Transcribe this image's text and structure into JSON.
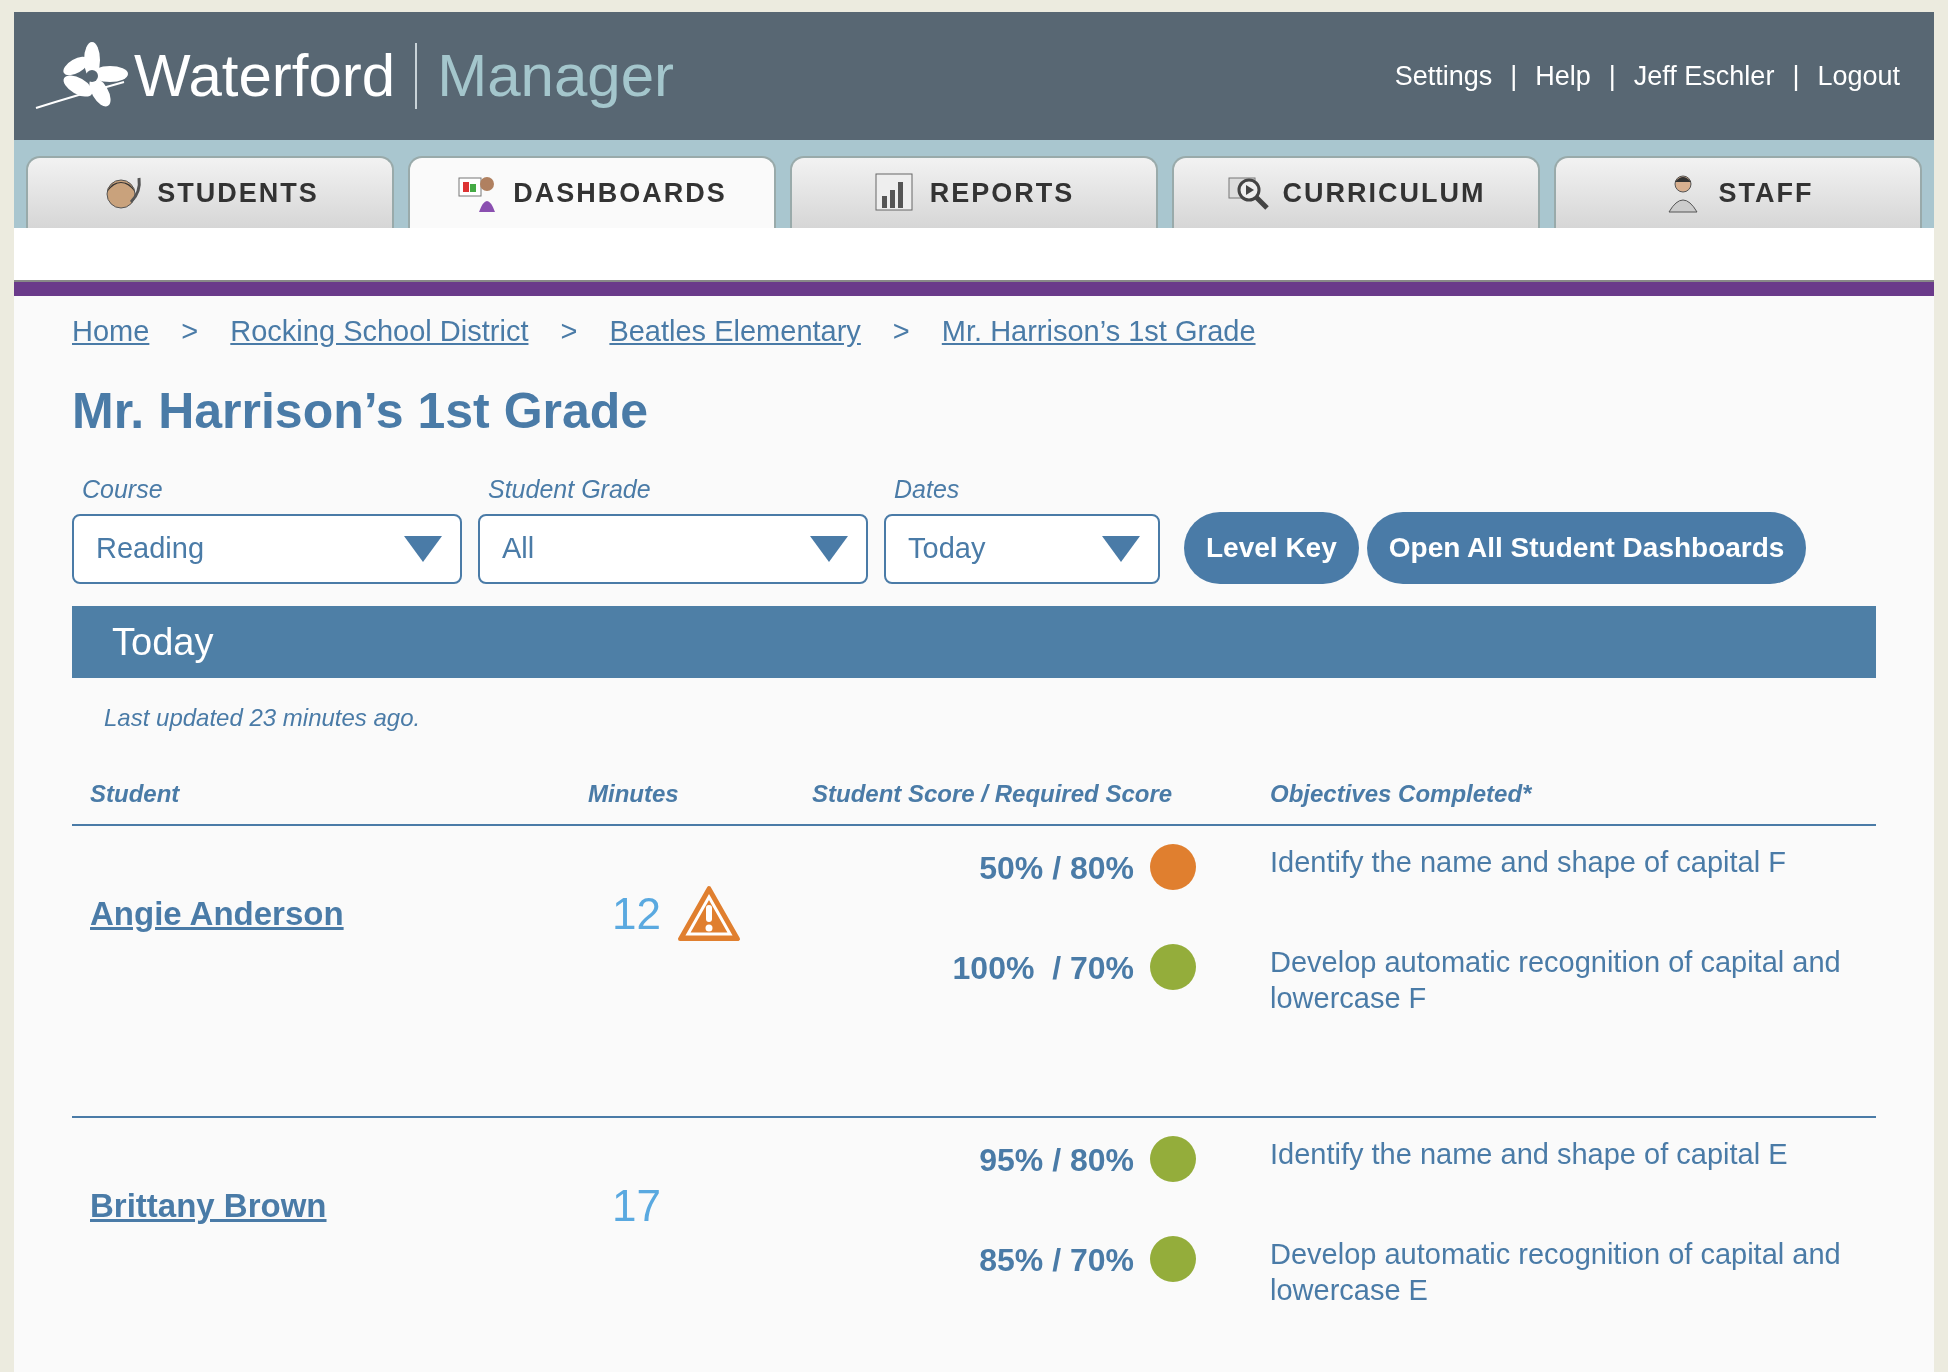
{
  "header": {
    "logo_text": "Waterford",
    "product": "Manager",
    "links": [
      {
        "label": "Settings"
      },
      {
        "label": "Help"
      },
      {
        "label": "Jeff Eschler"
      },
      {
        "label": "Logout"
      }
    ],
    "separator": "|"
  },
  "tabs": [
    {
      "label": "STUDENTS",
      "kind": "students",
      "selected": false
    },
    {
      "label": "DASHBOARDS",
      "kind": "dashboards",
      "selected": true
    },
    {
      "label": "REPORTS",
      "kind": "reports",
      "selected": false
    },
    {
      "label": "CURRICULUM",
      "kind": "curriculum",
      "selected": false
    },
    {
      "label": "STAFF",
      "kind": "staff",
      "selected": false
    }
  ],
  "breadcrumb": {
    "separator": ">",
    "items": [
      "Home",
      "Rocking School District",
      "Beatles Elementary",
      "Mr. Harrison’s 1st Grade"
    ]
  },
  "title": "Mr. Harrison’s 1st Grade",
  "filters": [
    {
      "label": "Course",
      "value": "Reading"
    },
    {
      "label": "Student Grade",
      "value": "All"
    },
    {
      "label": "Dates",
      "value": "Today"
    }
  ],
  "buttons": [
    "Level Key",
    "Open All Student Dashboards"
  ],
  "section": {
    "title": "Today",
    "updated": "Last updated 23 minutes ago."
  },
  "table": {
    "columns": [
      "Student",
      "Minutes",
      "Student Score / Required Score",
      "Objectives Completed*"
    ],
    "rows": [
      {
        "student": "Angie Anderson",
        "minutes": "12",
        "warning": true,
        "objectives": [
          {
            "score": "50% / 80%",
            "color": "#e07f2f",
            "objective": "Identify the name and shape of capital F"
          },
          {
            "score": "100%  / 70%",
            "color": "#94ad3b",
            "objective": "Develop automatic recognition of capital and lowercase F"
          }
        ]
      },
      {
        "student": "Brittany Brown",
        "minutes": "17",
        "warning": false,
        "objectives": [
          {
            "score": "95% / 80%",
            "color": "#94ad3b",
            "objective": "Identify the name and shape of capital E"
          },
          {
            "score": "85% / 70%",
            "color": "#94ad3b",
            "objective": "Develop automatic recognition of capital and lowercase E"
          }
        ]
      }
    ]
  }
}
